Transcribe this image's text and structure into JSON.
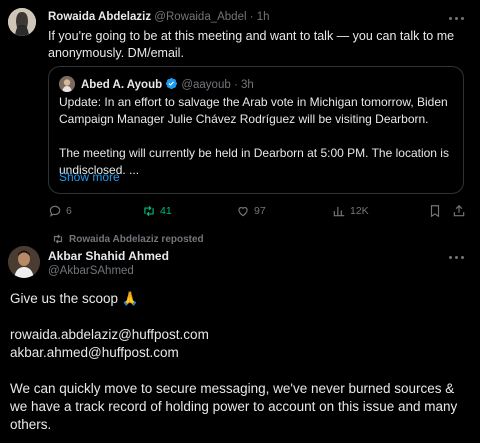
{
  "post1": {
    "author_name": "Rowaida Abdelaziz",
    "author_handle": "@Rowaida_Abdel",
    "separator": "·",
    "time": "1h",
    "text": "If you're going to be at this meeting and want to talk — you can talk to me anonymously. DM/email.",
    "quote": {
      "author_name": "Abed A. Ayoub",
      "author_handle": "@aayoub",
      "separator": "·",
      "time": "3h",
      "paragraph1": "Update: In an effort to salvage the Arab vote in Michigan tomorrow, Biden Campaign Manager Julie Chávez Rodríguez will be visiting Dearborn.",
      "paragraph2": "The meeting will currently be held in Dearborn at 5:00 PM. The location is undisclosed. ...",
      "show_more": "Show more"
    },
    "actions": {
      "replies": "6",
      "reposts": "41",
      "likes": "97",
      "views": "12K"
    }
  },
  "post2": {
    "repost_label": "Rowaida Abdelaziz reposted",
    "author_name": "Akbar Shahid Ahmed",
    "author_handle": "@AkbarSAhmed",
    "line1": "Give us the scoop 🙏",
    "email1": "rowaida.abdelaziz@huffpost.com",
    "email2": "akbar.ahmed@huffpost.com",
    "line_final": "We can quickly move to secure messaging, we've never burned sources & we have a track record of holding power to account on this issue and many others."
  },
  "colors": {
    "background": "#000000",
    "text": "#e7e9ea",
    "muted": "#71767b",
    "link": "#1d9bf0",
    "repost_green": "#00ba7c",
    "border": "#2f3336"
  }
}
